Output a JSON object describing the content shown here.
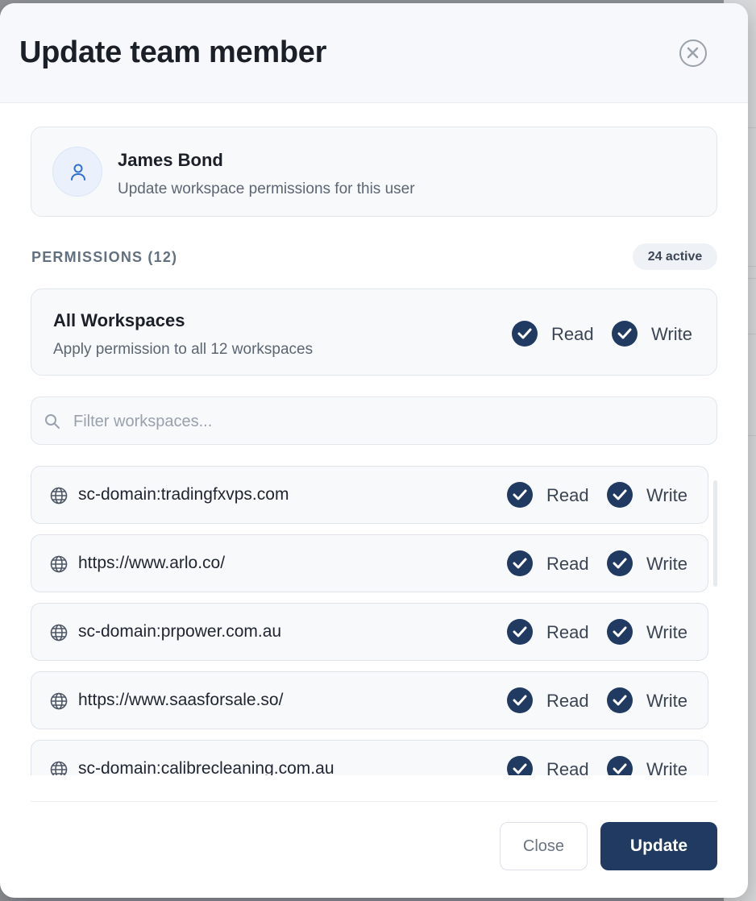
{
  "modal": {
    "title": "Update team member"
  },
  "user": {
    "name": "James Bond",
    "subtitle": "Update workspace permissions for this user"
  },
  "permissions": {
    "heading": "PERMISSIONS (12)",
    "active_badge": "24 active"
  },
  "all_workspaces": {
    "title": "All Workspaces",
    "subtitle": "Apply permission to all 12 workspaces",
    "read_label": "Read",
    "write_label": "Write",
    "read_checked": true,
    "write_checked": true
  },
  "search": {
    "placeholder": "Filter workspaces...",
    "value": ""
  },
  "workspaces": [
    {
      "name": "sc-domain:tradingfxvps.com",
      "read": "Read",
      "write": "Write"
    },
    {
      "name": "https://www.arlo.co/",
      "read": "Read",
      "write": "Write"
    },
    {
      "name": "sc-domain:prpower.com.au",
      "read": "Read",
      "write": "Write"
    },
    {
      "name": "https://www.saasforsale.so/",
      "read": "Read",
      "write": "Write"
    },
    {
      "name": "sc-domain:calibrecleaning.com.au",
      "read": "Read",
      "write": "Write"
    }
  ],
  "footer": {
    "close_label": "Close",
    "update_label": "Update"
  },
  "colors": {
    "accent": "#203a62",
    "card_bg": "#f8f9fb",
    "header_bg": "#f6f8fb"
  }
}
